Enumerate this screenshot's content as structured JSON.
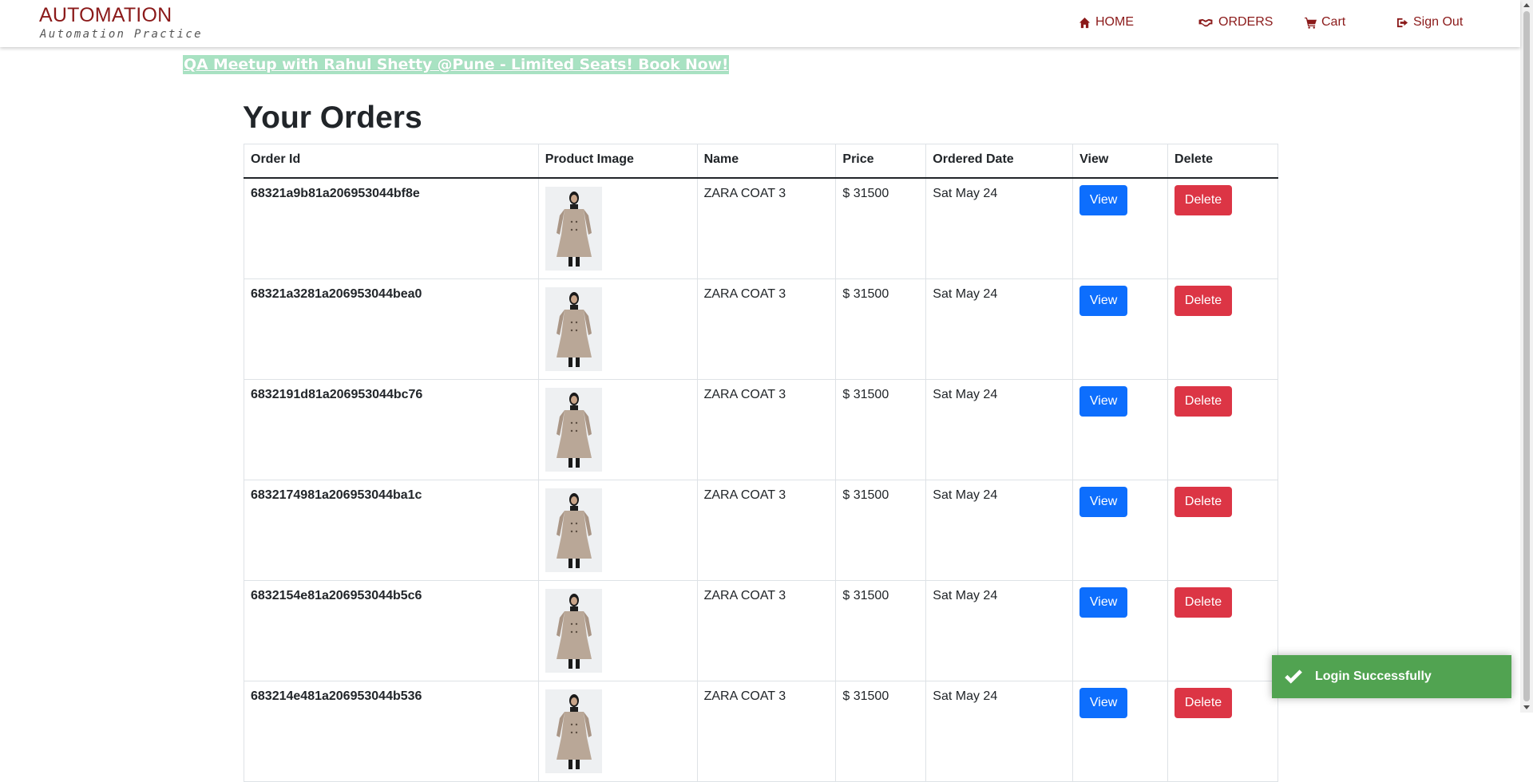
{
  "brand": {
    "title": "AUTOMATION",
    "subtitle": "Automation Practice"
  },
  "nav": {
    "home": "HOME",
    "orders": "ORDERS",
    "cart": "Cart",
    "signout": "Sign Out"
  },
  "promo": "QA Meetup with Rahul Shetty @Pune - Limited Seats! Book Now!",
  "page_title": "Your Orders",
  "table": {
    "headers": [
      "Order Id",
      "Product Image",
      "Name",
      "Price",
      "Ordered Date",
      "View",
      "Delete"
    ],
    "rows": [
      {
        "id": "68321a9b81a206953044bf8e",
        "name": "ZARA COAT 3",
        "price": "$ 31500",
        "date": "Sat May 24",
        "view": "View",
        "delete": "Delete"
      },
      {
        "id": "68321a3281a206953044bea0",
        "name": "ZARA COAT 3",
        "price": "$ 31500",
        "date": "Sat May 24",
        "view": "View",
        "delete": "Delete"
      },
      {
        "id": "6832191d81a206953044bc76",
        "name": "ZARA COAT 3",
        "price": "$ 31500",
        "date": "Sat May 24",
        "view": "View",
        "delete": "Delete"
      },
      {
        "id": "6832174981a206953044ba1c",
        "name": "ZARA COAT 3",
        "price": "$ 31500",
        "date": "Sat May 24",
        "view": "View",
        "delete": "Delete"
      },
      {
        "id": "6832154e81a206953044b5c6",
        "name": "ZARA COAT 3",
        "price": "$ 31500",
        "date": "Sat May 24",
        "view": "View",
        "delete": "Delete"
      },
      {
        "id": "683214e481a206953044b536",
        "name": "ZARA COAT 3",
        "price": "$ 31500",
        "date": "Sat May 24",
        "view": "View",
        "delete": "Delete"
      }
    ]
  },
  "toast": "Login Successfully",
  "colors": {
    "brand": "#8b1a1a",
    "view_button": "#0d6efd",
    "delete_button": "#dc3545",
    "toast": "#51a351",
    "promo_bg": "#a8e2c2"
  },
  "icons": {
    "home": "home-icon",
    "orders": "handshake-icon",
    "cart": "cart-icon",
    "signout": "sign-out-icon",
    "toast": "check-icon"
  }
}
